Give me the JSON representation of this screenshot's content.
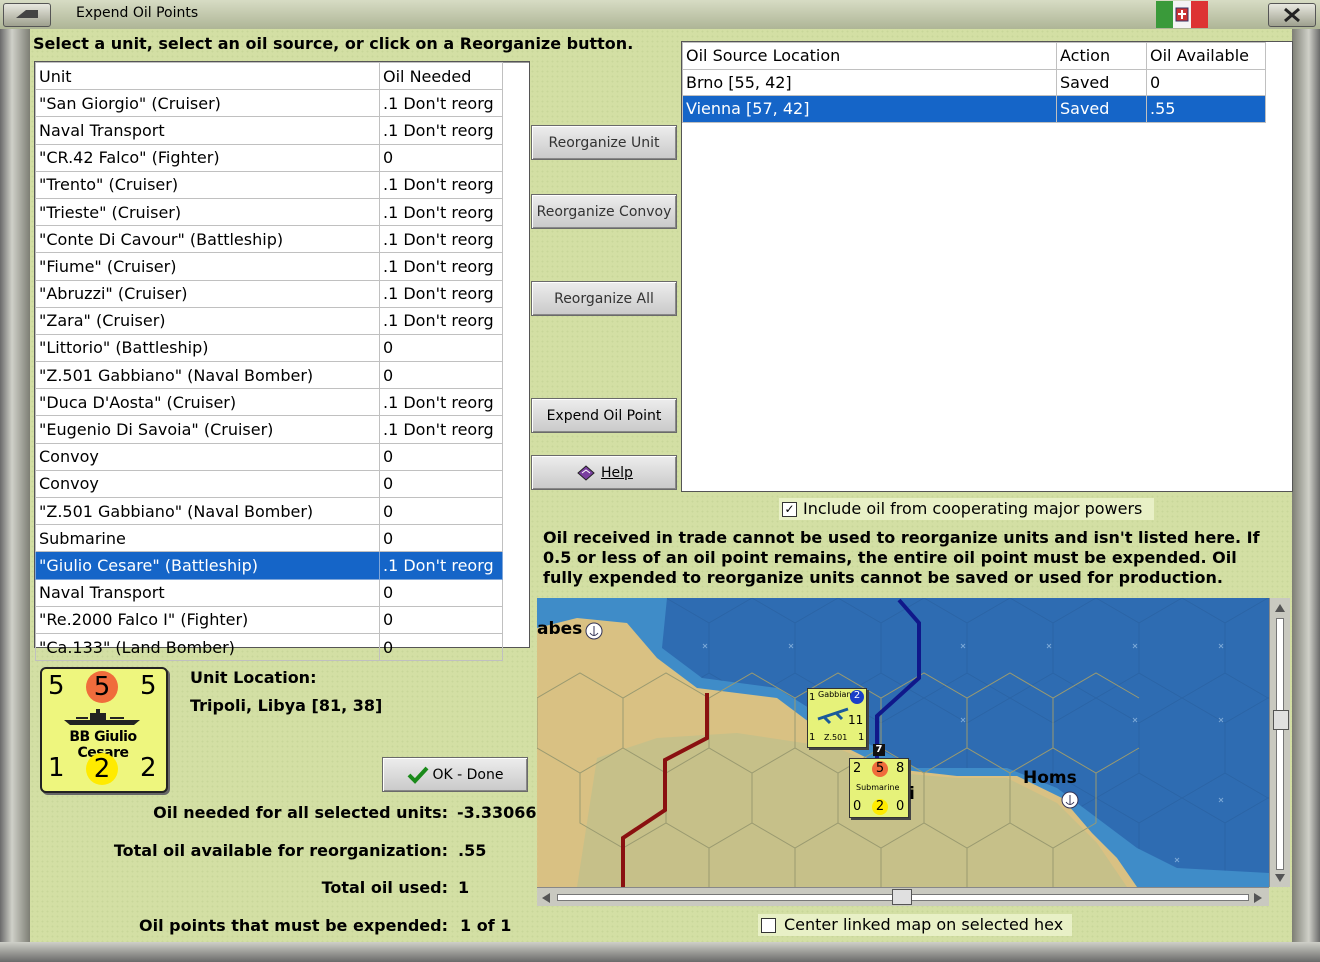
{
  "window": {
    "title": "Expend Oil Points"
  },
  "instruction": "Select a unit, select an oil source, or click on a Reorganize button.",
  "unit_table": {
    "headers": [
      "Unit",
      "Oil Needed"
    ],
    "rows": [
      [
        "\"San Giorgio\" (Cruiser)",
        ".1 Don't reorg"
      ],
      [
        "Naval Transport",
        ".1 Don't reorg"
      ],
      [
        "\"CR.42 Falco\" (Fighter)",
        "0"
      ],
      [
        "\"Trento\" (Cruiser)",
        ".1 Don't reorg"
      ],
      [
        "\"Trieste\" (Cruiser)",
        ".1 Don't reorg"
      ],
      [
        "\"Conte Di Cavour\" (Battleship)",
        ".1 Don't reorg"
      ],
      [
        "\"Fiume\" (Cruiser)",
        ".1 Don't reorg"
      ],
      [
        "\"Abruzzi\" (Cruiser)",
        ".1 Don't reorg"
      ],
      [
        "\"Zara\" (Cruiser)",
        ".1 Don't reorg"
      ],
      [
        "\"Littorio\" (Battleship)",
        "0"
      ],
      [
        "\"Z.501 Gabbiano\" (Naval Bomber)",
        "0"
      ],
      [
        "\"Duca D'Aosta\" (Cruiser)",
        ".1 Don't reorg"
      ],
      [
        "\"Eugenio Di Savoia\" (Cruiser)",
        ".1 Don't reorg"
      ],
      [
        "Convoy",
        "0"
      ],
      [
        "Convoy",
        "0"
      ],
      [
        "\"Z.501 Gabbiano\" (Naval Bomber)",
        "0"
      ],
      [
        "Submarine",
        "0"
      ],
      [
        "\"Giulio Cesare\" (Battleship)",
        ".1 Don't reorg"
      ],
      [
        "Naval Transport",
        "0"
      ],
      [
        "\"Re.2000 Falco I\" (Fighter)",
        "0"
      ],
      [
        "\"Ca.133\" (Land Bomber)",
        "0"
      ]
    ],
    "selected_index": 17
  },
  "oil_table": {
    "headers": [
      "Oil Source Location",
      "Action",
      "Oil Available"
    ],
    "rows": [
      [
        "Brno [55, 42]",
        "Saved",
        "0"
      ],
      [
        "Vienna [57, 42]",
        "Saved",
        ".55"
      ]
    ],
    "selected_index": 1
  },
  "buttons": {
    "reorganize_unit": "Reorganize Unit",
    "reorganize_convoy": "Reorganize Convoy",
    "reorganize_all": "Reorganize All",
    "expend_oil_point": "Expend Oil Point",
    "help": "Help",
    "ok_done": "OK - Done"
  },
  "include_oil": {
    "label": "Include oil from cooperating major powers",
    "checked": true
  },
  "note": "Oil received in trade cannot be used to reorganize units and isn't listed here.  If 0.5 or less of an oil point remains, the entire oil point must be expended.   Oil fully expended to reorganize units cannot be saved or used for production.",
  "counter": {
    "top_left": "5",
    "top_mid": "5",
    "top_right": "5",
    "name": "BB Giulio Cesare",
    "bot_left": "1",
    "bot_mid": "2",
    "bot_right": "2"
  },
  "unit_location": {
    "label": "Unit Location:",
    "value": "Tripoli, Libya [81, 38]"
  },
  "stats": {
    "oil_needed_label": "Oil needed for all selected units:",
    "oil_needed_value": "-3.33066",
    "total_available_label": "Total oil available for reorganization:",
    "total_available_value": ".55",
    "total_used_label": "Total oil used:",
    "total_used_value": "1",
    "must_expend_label": "Oil points that must be expended:",
    "must_expend_value": "1 of 1"
  },
  "map": {
    "labels": {
      "west": "abes",
      "homs": "Homs",
      "tripoli_partial": "i"
    },
    "air_counter": {
      "name": "Gabbiano",
      "type": "Z.501",
      "val1": "1",
      "val2": "2",
      "val3": "11",
      "val4": "1",
      "val5": "1"
    },
    "sub_counter": {
      "name": "Submarine",
      "a": "2",
      "b": "5",
      "c": "8",
      "d": "0",
      "e": "2",
      "f": "0"
    },
    "stack_badge": "7"
  },
  "center_map": {
    "label": "Center linked map on selected hex",
    "checked": false
  },
  "colors": {
    "selection": "#1565c8",
    "panel": "#d3dfa4",
    "sea": "#2f6fb3",
    "counter": "#eef67e"
  }
}
